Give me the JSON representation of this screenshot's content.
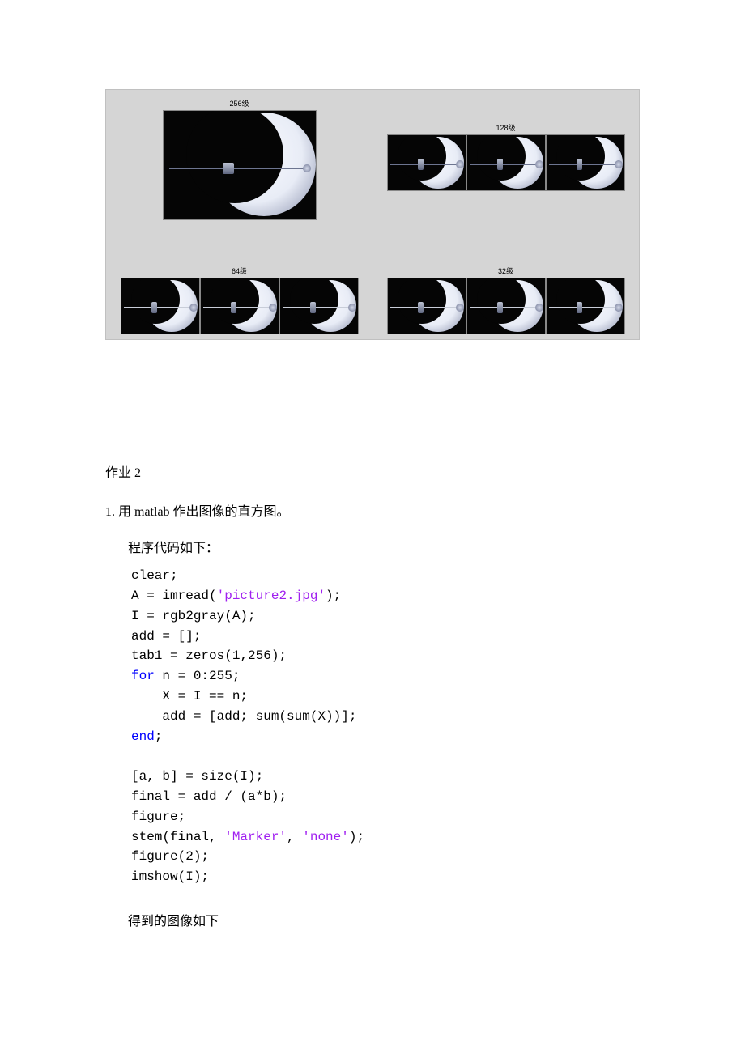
{
  "figure": {
    "quadrants": [
      {
        "title": "256级",
        "variant": "single-big"
      },
      {
        "title": "128级",
        "variant": "triple-sm"
      },
      {
        "title": "64级",
        "variant": "triple-sm"
      },
      {
        "title": "32级",
        "variant": "triple-sm"
      }
    ]
  },
  "text": {
    "hw_heading": "作业 2",
    "question": "1. 用 matlab 作出图像的直方图。",
    "code_intro": "程序代码如下：",
    "result_intro": "得到的图像如下"
  },
  "code": {
    "l01_a": "clear;",
    "l02_a": "A = imread(",
    "l02_str": "'picture2.jpg'",
    "l02_b": ");",
    "l03_a": "I = rgb2gray(A);",
    "l04_a": "add = [];",
    "l05_a": "tab1 = zeros(1,256);",
    "l06_kw": "for",
    "l06_a": " n = 0:255;",
    "l07_a": "    X = I == n;",
    "l08_a": "    add = [add; sum(sum(X))];",
    "l09_kw": "end",
    "l09_a": ";",
    "blank": " ",
    "l10_a": "[a, b] = size(I);",
    "l11_a": "final = add / (a*b);",
    "l12_a": "figure;",
    "l13_a": "stem(final, ",
    "l13_s1": "'Marker'",
    "l13_b": ", ",
    "l13_s2": "'none'",
    "l13_c": ");",
    "l14_a": "figure(2);",
    "l15_a": "imshow(I);"
  }
}
